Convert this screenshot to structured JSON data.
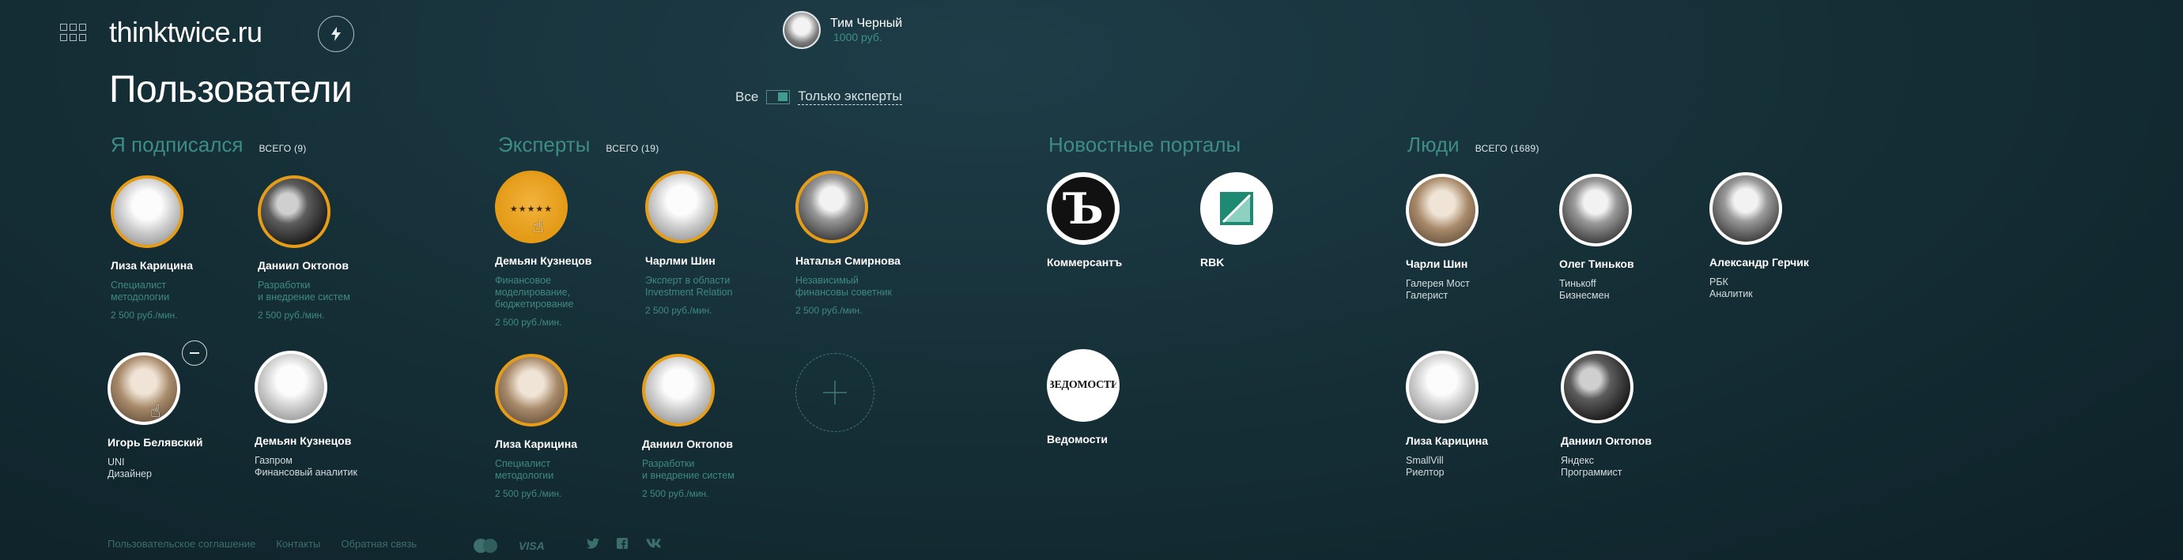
{
  "header": {
    "logo": "thinktwice.ru",
    "user_name": "Тим Черный",
    "user_balance": "1000 руб."
  },
  "page": {
    "title": "Пользователи",
    "filter_all": "Все",
    "filter_experts": "Только эксперты"
  },
  "subscribed": {
    "title": "Я подписался",
    "count": "ВСЕГО (9)",
    "cards": [
      {
        "name": "Лиза Карицина",
        "desc": [
          "Специалист",
          "методологии"
        ],
        "price": "2 500 руб./мин."
      },
      {
        "name": "Даниил Октопов",
        "desc": [
          "Разработки",
          "и внедрение систем"
        ],
        "price": "2 500 руб./мин."
      },
      {
        "name": "Игорь Белявский",
        "desc": [
          "UNI",
          "Дизайнер"
        ]
      },
      {
        "name": "Демьян Кузнецов",
        "desc": [
          "Газпром",
          "Финансовый аналитик"
        ]
      }
    ]
  },
  "experts": {
    "title": "Эксперты",
    "count": "ВСЕГО (19)",
    "cards": [
      {
        "name": "Демьян Кузнецов",
        "desc": [
          "Финансовое",
          "моделирование,",
          "бюджетирование"
        ],
        "price": "2 500 руб./мин.",
        "rating": "★★★★★"
      },
      {
        "name": "Чарлми Шин",
        "desc": [
          "Эксперт в области",
          "Investment Relation"
        ],
        "price": "2 500 руб./мин."
      },
      {
        "name": "Наталья Смирнова",
        "desc": [
          "Независимый",
          "финансовы советник"
        ],
        "price": "2 500 руб./мин."
      },
      {
        "name": "Лиза Карицина",
        "desc": [
          "Специалист",
          "методологии"
        ],
        "price": "2 500 руб./мин."
      },
      {
        "name": "Даниил Октопов",
        "desc": [
          "Разработки",
          "и внедрение систем"
        ],
        "price": "2 500 руб./мин."
      }
    ]
  },
  "portals": {
    "title": "Новостные порталы",
    "items": [
      {
        "name": "Коммерсантъ",
        "logo_text": "Ъ"
      },
      {
        "name": "RBK"
      },
      {
        "name": "Ведомости",
        "logo_text": "ВЕДОМОСТИ"
      }
    ]
  },
  "people": {
    "title": "Люди",
    "count": "ВСЕГО (1689)",
    "cards": [
      {
        "name": "Чарли Шин",
        "desc": [
          "Галерея Мост",
          "Галерист"
        ]
      },
      {
        "name": "Олег Тиньков",
        "desc": [
          "Тинькoff",
          "Бизнесмен"
        ]
      },
      {
        "name": "Александр Герчик",
        "desc": [
          "РБК",
          "Аналитик"
        ]
      },
      {
        "name": "Лиза Карицина",
        "desc": [
          "SmallVill",
          "Риелтор"
        ]
      },
      {
        "name": "Даниил Октопов",
        "desc": [
          "Яндекс",
          "Программист"
        ]
      }
    ]
  },
  "footer": {
    "links": [
      "Пользовательское соглашение",
      "Контакты",
      "Обратная связь"
    ],
    "visa": "VISA"
  },
  "colors": {
    "accent": "#3d8c86",
    "gold_border": "#e59c19",
    "background": "#163038"
  }
}
